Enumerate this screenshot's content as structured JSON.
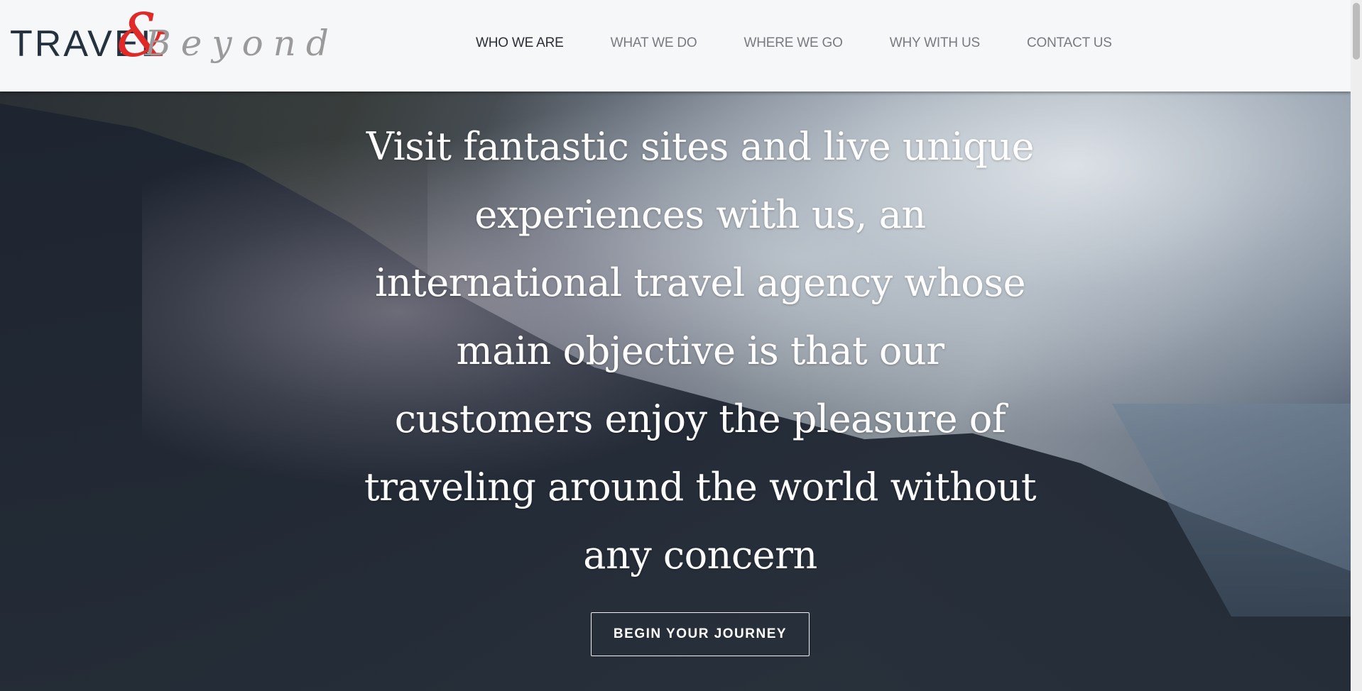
{
  "logo": {
    "travel": "TRAVEL",
    "ampersand": "&",
    "beyond": "Beyond"
  },
  "nav": {
    "items": [
      {
        "label": "WHO WE ARE",
        "active": true
      },
      {
        "label": "WHAT WE DO"
      },
      {
        "label": "WHERE WE GO"
      },
      {
        "label": "WHY WITH US"
      },
      {
        "label": "CONTACT US"
      }
    ]
  },
  "hero": {
    "headline": "Visit fantastic sites and live unique experiences with us, an international travel agency whose main objective is that our customers enjoy the pleasure of traveling around the world without any concern",
    "cta_label": "BEGIN YOUR JOURNEY"
  },
  "colors": {
    "header_bg": "#f6f7f9",
    "nav_active": "#2a2f36",
    "nav_inactive": "#777b80",
    "logo_red": "#e02a2a",
    "logo_dark": "#24313e",
    "hero_text": "#ffffff"
  }
}
